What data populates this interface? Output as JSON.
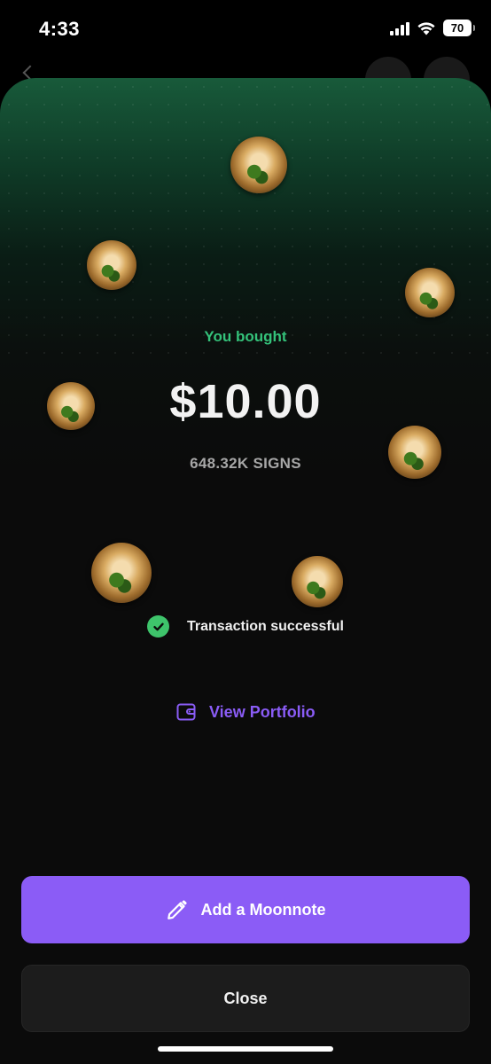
{
  "status_bar": {
    "time": "4:33",
    "battery_level": "70",
    "icons": [
      "signal-icon",
      "wifi-icon",
      "battery-icon"
    ]
  },
  "purchase": {
    "heading": "You bought",
    "amount": "$10.00",
    "token_amount": "648.32K SIGNS"
  },
  "status": {
    "message": "Transaction successful",
    "icon": "check-circle-icon"
  },
  "links": {
    "portfolio_label": "View Portfolio",
    "portfolio_icon": "wallet-icon"
  },
  "actions": {
    "moonnote_label": "Add a Moonnote",
    "moonnote_icon": "pencil-icon",
    "close_label": "Close"
  },
  "colors": {
    "accent_purple": "#8b5cf6",
    "success_green": "#34c27a",
    "check_green": "#3ec46b",
    "header_green": "#185a3a"
  }
}
